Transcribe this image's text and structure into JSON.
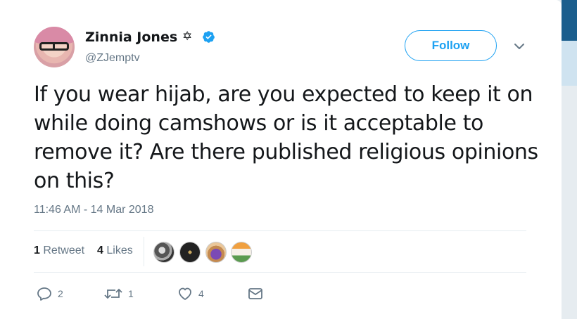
{
  "user": {
    "name": "Zinnia Jones",
    "name_symbol": "✡",
    "handle": "@ZJemptv",
    "verified": true
  },
  "header": {
    "follow_label": "Follow"
  },
  "tweet": {
    "text": "If you wear hijab, are you expected to keep it on while doing camshows or is it acceptable to remove it? Are there published religious opinions on this?",
    "timestamp": "11:46 AM - 14 Mar 2018"
  },
  "stats": {
    "retweets_count": "1",
    "retweets_label": "Retweet",
    "likes_count": "4",
    "likes_label": "Likes"
  },
  "actions": {
    "reply_count": "2",
    "retweet_count": "1",
    "like_count": "4"
  },
  "icons": {
    "verified": "verified-badge-icon",
    "chevron": "chevron-down-icon",
    "reply": "reply-icon",
    "retweet": "retweet-icon",
    "like": "heart-icon",
    "dm": "envelope-icon"
  },
  "colors": {
    "accent": "#1da1f2",
    "text": "#14171a",
    "secondary": "#657786",
    "divider": "#e6ecf0"
  }
}
